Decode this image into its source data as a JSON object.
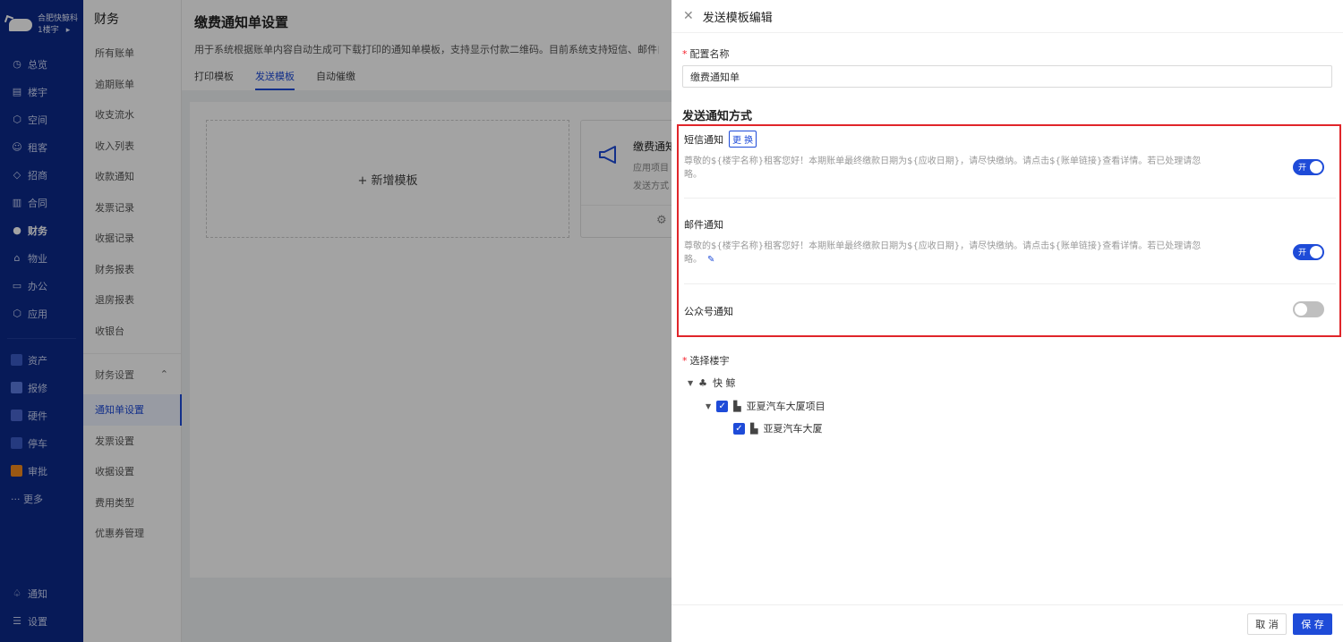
{
  "nav": {
    "brand_name": "合肥快鲸科",
    "brand_sub": "1楼宇",
    "brand_arrow": "▸",
    "items": [
      {
        "icon": "dashboard-icon",
        "glyph": "◷",
        "label": "总览"
      },
      {
        "icon": "building-icon",
        "glyph": "▤",
        "label": "楼宇"
      },
      {
        "icon": "cube-icon",
        "glyph": "⬡",
        "label": "空间"
      },
      {
        "icon": "tenant-icon",
        "glyph": "☺",
        "label": "租客"
      },
      {
        "icon": "tag-icon",
        "glyph": "◇",
        "label": "招商"
      },
      {
        "icon": "contract-icon",
        "glyph": "▥",
        "label": "合同"
      },
      {
        "icon": "finance-icon",
        "glyph": "●",
        "label": "财务"
      },
      {
        "icon": "property-icon",
        "glyph": "⌂",
        "label": "物业"
      },
      {
        "icon": "office-icon",
        "glyph": "▭",
        "label": "办公"
      },
      {
        "icon": "apps-icon",
        "glyph": "⬡",
        "label": "应用"
      }
    ],
    "colored_items": [
      {
        "icon": "asset-icon",
        "color": "#3a5bc7",
        "label": "资产"
      },
      {
        "icon": "repair-icon",
        "color": "#5b7be0",
        "label": "报修"
      },
      {
        "icon": "hardware-icon",
        "color": "#4a67d0",
        "label": "硬件"
      },
      {
        "icon": "parking-icon",
        "color": "#3a5bc7",
        "label": "停车"
      },
      {
        "icon": "approval-icon",
        "color": "#f28a1e",
        "label": "审批"
      }
    ],
    "more_label": "··· 更多",
    "bottom": [
      {
        "icon": "bell-icon",
        "glyph": "♤",
        "label": "通知"
      },
      {
        "icon": "settings-icon",
        "glyph": "☰",
        "label": "设置"
      }
    ]
  },
  "menu2": {
    "title": "财务",
    "items": [
      "所有账单",
      "逾期账单",
      "收支流水",
      "收入列表",
      "收款通知",
      "发票记录",
      "收据记录",
      "财务报表",
      "退房报表",
      "收银台"
    ],
    "group_label": "财务设置",
    "group_arrow": "⌃",
    "sub_items": [
      "通知单设置",
      "发票设置",
      "收据设置",
      "费用类型",
      "优惠券管理"
    ]
  },
  "main": {
    "title": "缴费通知单设置",
    "desc": "用于系统根据账单内容自动生成可下载打印的通知单模板，支持显示付款二维码。目前系统支持短信、邮件自动",
    "tabs": [
      "打印模板",
      "发送模板",
      "自动催缴"
    ],
    "add_template": "+ 新增模板",
    "card_title": "缴费通知",
    "card_line1": "应用项目",
    "card_line2": "发送方式"
  },
  "drawer": {
    "title": "发送模板编辑",
    "name_label": "配置名称",
    "name_value": "缴费通知单",
    "section_title": "发送通知方式",
    "sms_label": "短信通知",
    "sms_change": "更 换",
    "sms_text": "尊敬的${楼宇名称}租客您好！本期账单最终缴款日期为${应收日期}，请尽快缴纳。请点击${账单链接}查看详情。若已处理请忽略。",
    "sms_switch_text": "开",
    "email_label": "邮件通知",
    "email_text": "尊敬的${楼宇名称}租客您好！本期账单最终缴款日期为${应收日期}，请尽快缴纳。请点击${账单链接}查看详情。若已处理请忽略。",
    "email_switch_text": "开",
    "wechat_label": "公众号通知",
    "building_label": "选择楼宇",
    "tree": {
      "root": "快 鲸",
      "project": "亚夏汽车大厦项目",
      "building": "亚夏汽车大厦"
    },
    "cancel_label": "取 消",
    "save_label": "保 存"
  }
}
